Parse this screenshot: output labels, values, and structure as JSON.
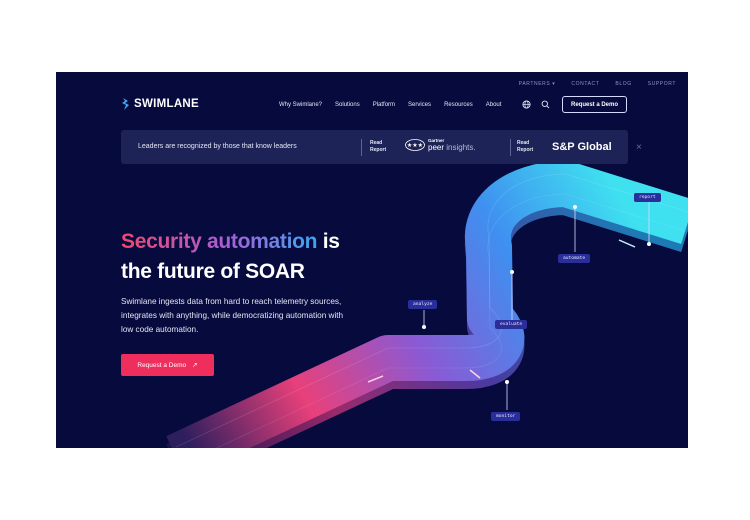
{
  "brand": {
    "name": "SWIMLANE"
  },
  "utility_nav": [
    "PARTNERS ▾",
    "CONTACT",
    "BLOG",
    "SUPPORT"
  ],
  "nav": [
    "Why Swimlane?",
    "Solutions",
    "Platform",
    "Services",
    "Resources",
    "About"
  ],
  "header_cta": "Request a Demo",
  "banner": {
    "message": "Leaders are recognized by those that know leaders",
    "read1": [
      "Read",
      "Report"
    ],
    "gartner_small": "Gartner",
    "gartner_big_a": "peer",
    "gartner_big_b": " insights.",
    "read2": [
      "Read",
      "Report"
    ],
    "sp": "S&P Global",
    "close": "×"
  },
  "hero": {
    "line1_gradient": "Security automation",
    "line1_rest": " is",
    "line2": "the future of SOAR",
    "sub": "Swimlane ingests data from hard to reach telemetry sources, integrates with anything, while democratizing automation with low code automation.",
    "cta": "Request a Demo",
    "cta_arrow": "↗"
  },
  "tags": [
    "report",
    "automate",
    "analyze",
    "evaluate",
    "monitor"
  ],
  "colors": {
    "bg": "#070a3d",
    "banner": "#1d2356",
    "cta": "#ef2e5e",
    "tag": "#2a2e9a"
  }
}
